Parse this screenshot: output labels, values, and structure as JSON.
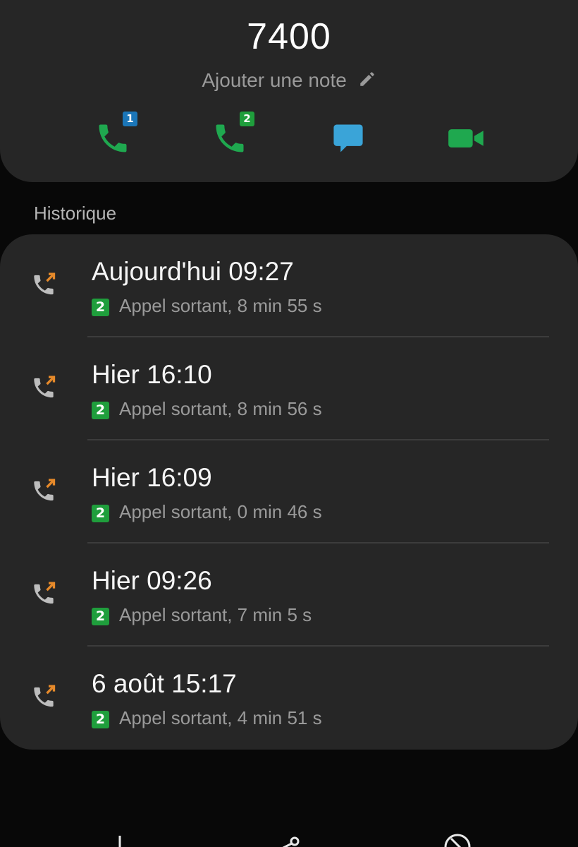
{
  "contact": {
    "number": "7400",
    "note_label": "Ajouter une note"
  },
  "actions": [
    {
      "name": "call-sim1",
      "icon": "phone-icon",
      "sim": "1",
      "color": "#1fa84f"
    },
    {
      "name": "call-sim2",
      "icon": "phone-icon",
      "sim": "2",
      "color": "#1fa84f"
    },
    {
      "name": "message",
      "icon": "message-icon",
      "color": "#3aa4d8"
    },
    {
      "name": "video-call",
      "icon": "video-icon",
      "color": "#1fa84f"
    }
  ],
  "history": {
    "title": "Historique",
    "items": [
      {
        "time": "Aujourd'hui 09:27",
        "sim": "2",
        "detail": "Appel sortant, 8 min 55 s"
      },
      {
        "time": "Hier 16:10",
        "sim": "2",
        "detail": "Appel sortant, 8 min 56 s"
      },
      {
        "time": "Hier 16:09",
        "sim": "2",
        "detail": "Appel sortant, 0 min 46 s"
      },
      {
        "time": "Hier 09:26",
        "sim": "2",
        "detail": "Appel sortant, 7 min 5 s"
      },
      {
        "time": "6 août 15:17",
        "sim": "2",
        "detail": "Appel sortant, 4 min 51 s"
      }
    ]
  },
  "colors": {
    "sim1_badge": "#1b76b8",
    "sim2_badge": "#1f9e3c",
    "outgoing_arrow": "#e5892a",
    "background": "#080808",
    "card": "#262626"
  },
  "bottom_bar_icons": [
    "add-contact-icon",
    "share-icon",
    "block-icon"
  ]
}
